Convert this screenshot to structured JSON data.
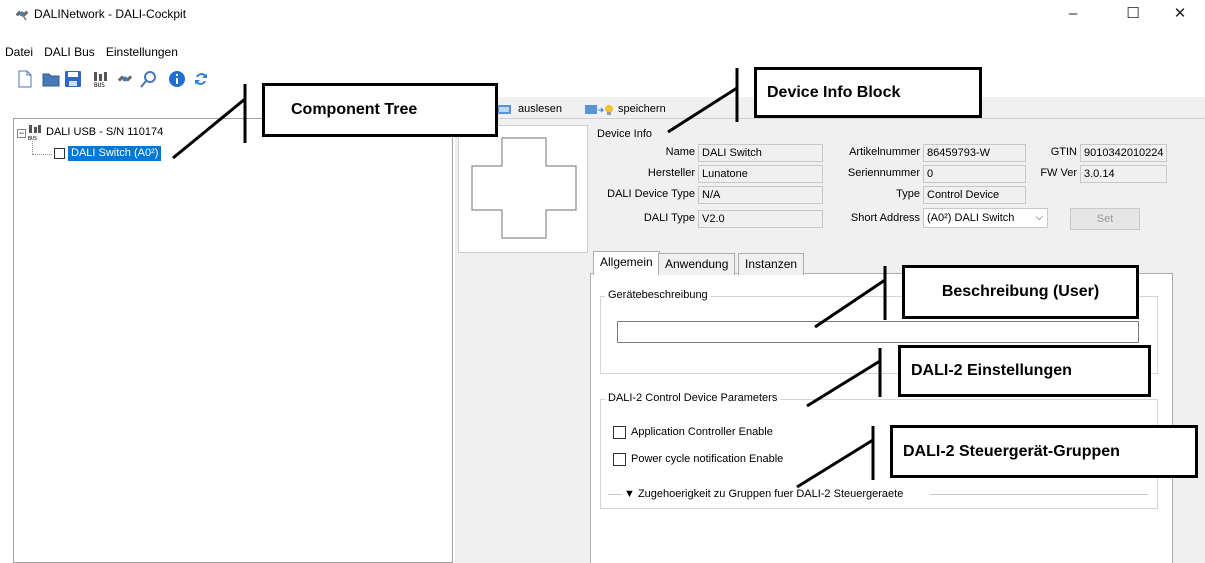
{
  "window": {
    "title": "DALINetwork - DALI-Cockpit",
    "minimize": "–",
    "maximize": "☐",
    "close": "✕"
  },
  "menu": [
    {
      "label": "Datei"
    },
    {
      "label": "DALI Bus"
    },
    {
      "label": "Einstellungen"
    }
  ],
  "toolbar": {
    "read_label": "auslesen",
    "save_label": "speichern"
  },
  "tree": {
    "root_label": "DALI USB - S/N 110174",
    "child_label": "DALI Switch (A0²)"
  },
  "device_info": {
    "group_label": "Device Info",
    "name_label": "Name",
    "name_value": "DALI Switch",
    "manufacturer_label": "Hersteller",
    "manufacturer_value": "Lunatone",
    "device_type_label": "DALI Device Type",
    "device_type_value": "N/A",
    "dali_type_label": "DALI Type",
    "dali_type_value": "V2.0",
    "article_label": "Artikelnummer",
    "article_value": "86459793-W",
    "serial_label": "Seriennummer",
    "serial_value": "0",
    "type_label": "Type",
    "type_value": "Control Device",
    "short_address_label": "Short Address",
    "short_address_value": "(A0²) DALI Switch",
    "gtin_label": "GTIN",
    "gtin_value": "9010342010224",
    "fw_label": "FW Ver",
    "fw_value": "3.0.14",
    "set_label": "Set"
  },
  "tabs": [
    {
      "label": "Allgemein"
    },
    {
      "label": "Anwendung"
    },
    {
      "label": "Instanzen"
    }
  ],
  "general": {
    "description_group": "Gerätebeschreibung",
    "description_value": "",
    "params_group": "DALI-2 Control Device Parameters",
    "app_ctrl_label": "Application Controller Enable",
    "power_cycle_label": "Power cycle notification Enable",
    "groups_label": "▼ Zugehoerigkeit zu Gruppen fuer DALI-2 Steuergeraete"
  },
  "callouts": {
    "component_tree": "Component Tree",
    "device_info": "Device Info Block",
    "description": "Beschreibung (User)",
    "dali2_settings": "DALI-2 Einstellungen",
    "dali2_groups": "DALI-2 Steuergerät-Gruppen"
  },
  "colors": {
    "selection": "#0078d7",
    "panel_bg": "#f0f0f0"
  }
}
